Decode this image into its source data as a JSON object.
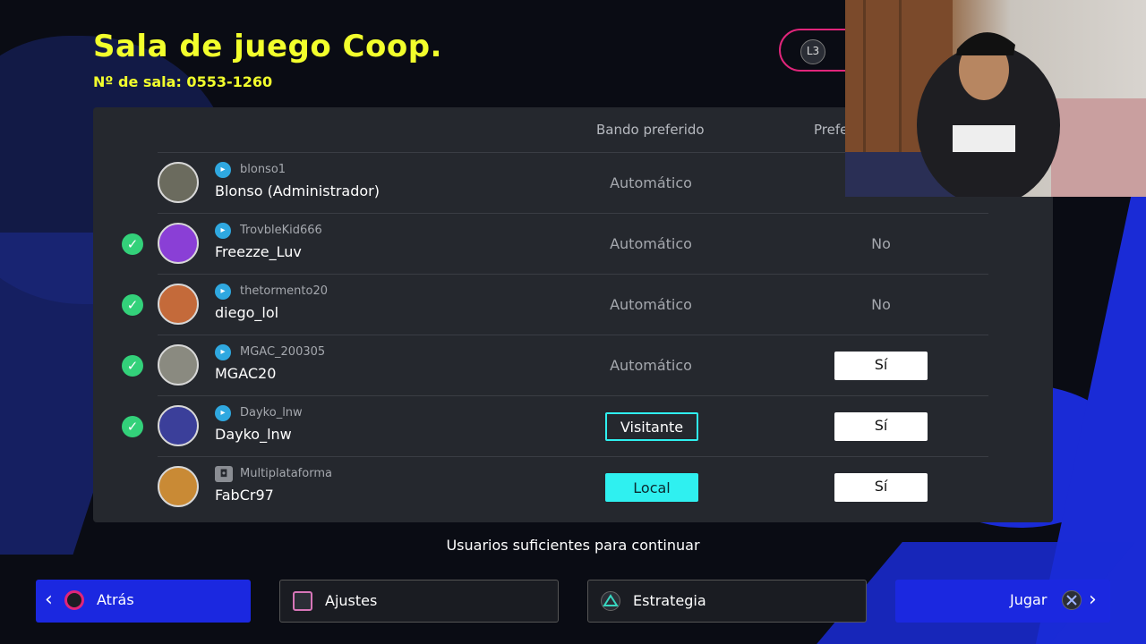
{
  "header": {
    "title": "Sala de juego Coop.",
    "room_number": "Nº de sala: 0553-1260",
    "l3_label": "L3"
  },
  "columns": {
    "side": "Bando preferido",
    "pref": "Prefe"
  },
  "players": [
    {
      "handle": "blonso1",
      "name": "Blonso (Administrador)",
      "platform": "psn",
      "ready": false,
      "side": "Automático",
      "side_style": "text",
      "pref": "",
      "pref_style": "none"
    },
    {
      "handle": "TrovbleKid666",
      "name": "Freezze_Luv",
      "platform": "psn",
      "ready": true,
      "side": "Automático",
      "side_style": "text",
      "pref": "No",
      "pref_style": "text"
    },
    {
      "handle": "thetormento20",
      "name": "diego_lol",
      "platform": "psn",
      "ready": true,
      "side": "Automático",
      "side_style": "text",
      "pref": "No",
      "pref_style": "text"
    },
    {
      "handle": "MGAC_200305",
      "name": "MGAC20",
      "platform": "psn",
      "ready": true,
      "side": "Automático",
      "side_style": "text",
      "pref": "Sí",
      "pref_style": "button"
    },
    {
      "handle": "Dayko_lnw",
      "name": "Dayko_lnw",
      "platform": "psn",
      "ready": true,
      "side": "Visitante",
      "side_style": "visit",
      "pref": "Sí",
      "pref_style": "button"
    },
    {
      "handle": "Multiplataforma",
      "name": "FabCr97",
      "platform": "multi",
      "ready": false,
      "side": "Local",
      "side_style": "local",
      "pref": "Sí",
      "pref_style": "button"
    }
  ],
  "status": "Usuarios suficientes para continuar",
  "footer": {
    "back": "Atrás",
    "settings": "Ajustes",
    "strategy": "Estrategia",
    "play": "Jugar"
  },
  "colors": {
    "title": "#f2ff2c",
    "accent_blue": "#1b28e0",
    "cyan": "#2ff0f0",
    "ready_green": "#33d17a"
  }
}
